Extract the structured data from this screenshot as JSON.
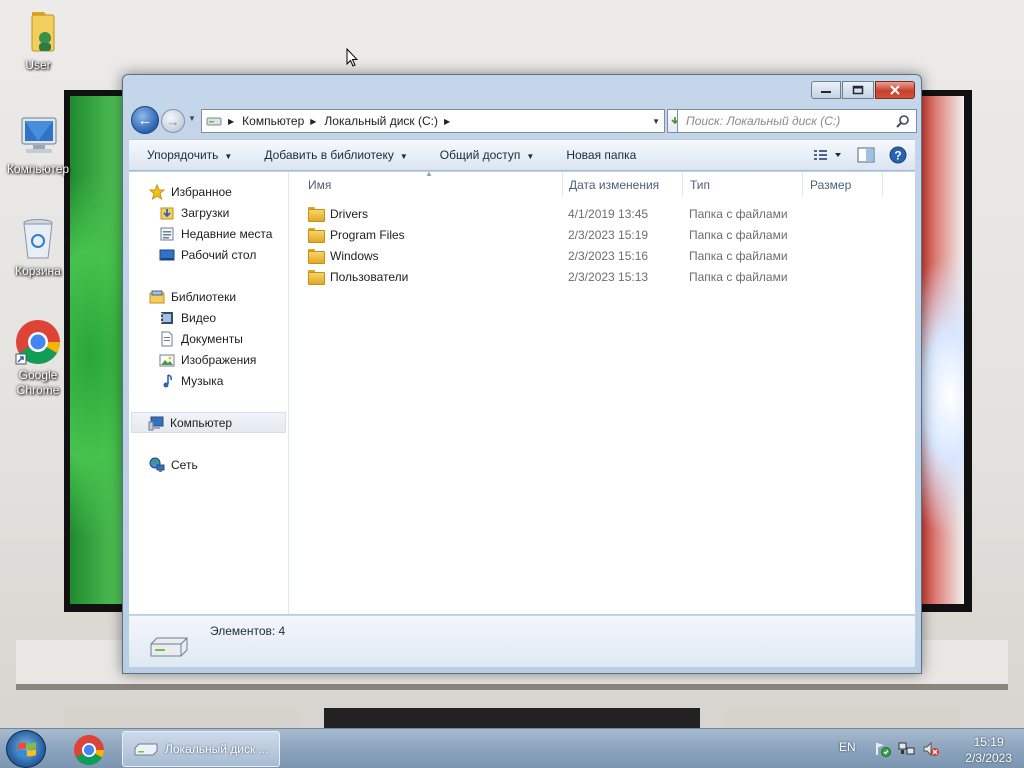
{
  "desktop": {
    "icons": [
      {
        "label": "User",
        "icon": "user-folder-icon"
      },
      {
        "label": "Компьютер",
        "icon": "computer-icon"
      },
      {
        "label": "Корзина",
        "icon": "recycle-bin-icon"
      },
      {
        "label": "Google Chrome",
        "icon": "chrome-icon"
      }
    ]
  },
  "window": {
    "controls": {
      "minimize": "minimize-icon",
      "maximize": "maximize-icon",
      "close": "close-icon"
    },
    "address": {
      "crumbs": [
        "Компьютер",
        "Локальный диск (C:)"
      ]
    },
    "search": {
      "placeholder": "Поиск: Локальный диск (C:)"
    },
    "toolbar": {
      "organize": "Упорядочить",
      "add_to_library": "Добавить в библиотеку",
      "share": "Общий доступ",
      "new_folder": "Новая папка"
    },
    "nav_pane": {
      "favorites": {
        "label": "Избранное",
        "items": [
          "Загрузки",
          "Недавние места",
          "Рабочий стол"
        ]
      },
      "libraries": {
        "label": "Библиотеки",
        "items": [
          "Видео",
          "Документы",
          "Изображения",
          "Музыка"
        ]
      },
      "computer": "Компьютер",
      "network": "Сеть"
    },
    "columns": [
      "Имя",
      "Дата изменения",
      "Тип",
      "Размер"
    ],
    "rows": [
      {
        "name": "Drivers",
        "date": "4/1/2019 13:45",
        "type": "Папка с файлами",
        "size": ""
      },
      {
        "name": "Program Files",
        "date": "2/3/2023 15:19",
        "type": "Папка с файлами",
        "size": ""
      },
      {
        "name": "Windows",
        "date": "2/3/2023 15:16",
        "type": "Папка с файлами",
        "size": ""
      },
      {
        "name": "Пользователи",
        "date": "2/3/2023 15:13",
        "type": "Папка с файлами",
        "size": ""
      }
    ],
    "status": "Элементов: 4"
  },
  "taskbar": {
    "task_label": "Локальный диск ...",
    "lang": "EN",
    "time": "15:19",
    "date": "2/3/2023"
  },
  "colors": {
    "accent": "#2a62b3",
    "folder": "#e2a925",
    "close": "#c7412c"
  }
}
